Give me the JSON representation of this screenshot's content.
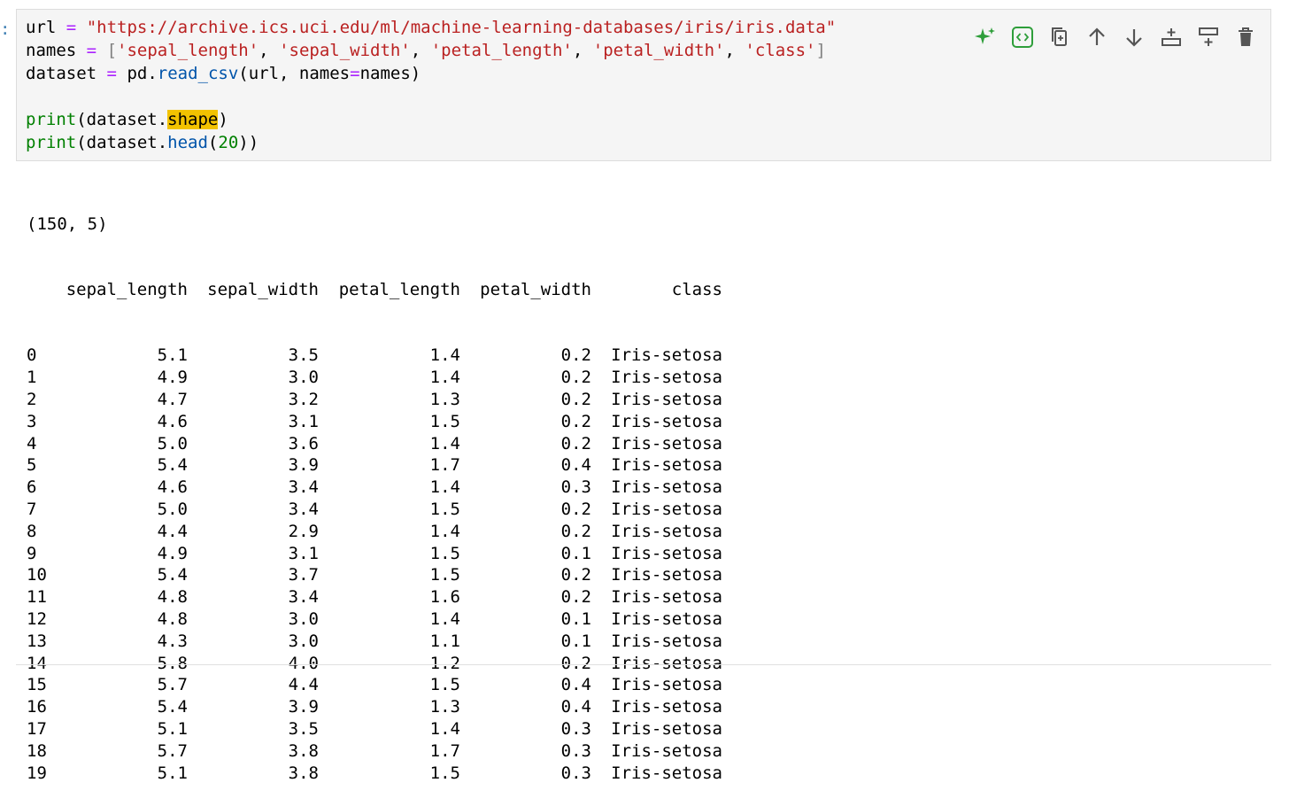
{
  "prompt": ":",
  "code": {
    "url_var": "url",
    "eq": "=",
    "url_string": "\"https://archive.ics.uci.edu/ml/machine-learning-databases/iris/iris.data\"",
    "names_var": "names",
    "open_bracket": "[",
    "close_bracket": "]",
    "comma": ",",
    "names_list": [
      "'sepal_length'",
      "'sepal_width'",
      "'petal_length'",
      "'petal_width'",
      "'class'"
    ],
    "dataset_var": "dataset",
    "pd": "pd.",
    "read_csv": "read_csv",
    "read_csv_args_a": "(url, names",
    "read_csv_args_b": "names)",
    "print": "print",
    "shape_prefix": "(dataset.",
    "shape_attr": "shape",
    "close_paren": ")",
    "head_prefix": "(dataset.",
    "head_func": "head",
    "head_open": "(",
    "head_arg": "20",
    "head_close": "))"
  },
  "toolbar": {
    "icons": [
      "sparkle-icon",
      "code-icon",
      "copy-icon",
      "arrow-up-icon",
      "arrow-down-icon",
      "insert-above-icon",
      "insert-below-icon",
      "trash-icon"
    ],
    "accent": "#2e9e3a"
  },
  "output": {
    "shape": "(150, 5)",
    "columns": [
      "sepal_length",
      "sepal_width",
      "petal_length",
      "petal_width",
      "class"
    ],
    "rows": [
      [
        "0",
        "5.1",
        "3.5",
        "1.4",
        "0.2",
        "Iris-setosa"
      ],
      [
        "1",
        "4.9",
        "3.0",
        "1.4",
        "0.2",
        "Iris-setosa"
      ],
      [
        "2",
        "4.7",
        "3.2",
        "1.3",
        "0.2",
        "Iris-setosa"
      ],
      [
        "3",
        "4.6",
        "3.1",
        "1.5",
        "0.2",
        "Iris-setosa"
      ],
      [
        "4",
        "5.0",
        "3.6",
        "1.4",
        "0.2",
        "Iris-setosa"
      ],
      [
        "5",
        "5.4",
        "3.9",
        "1.7",
        "0.4",
        "Iris-setosa"
      ],
      [
        "6",
        "4.6",
        "3.4",
        "1.4",
        "0.3",
        "Iris-setosa"
      ],
      [
        "7",
        "5.0",
        "3.4",
        "1.5",
        "0.2",
        "Iris-setosa"
      ],
      [
        "8",
        "4.4",
        "2.9",
        "1.4",
        "0.2",
        "Iris-setosa"
      ],
      [
        "9",
        "4.9",
        "3.1",
        "1.5",
        "0.1",
        "Iris-setosa"
      ],
      [
        "10",
        "5.4",
        "3.7",
        "1.5",
        "0.2",
        "Iris-setosa"
      ],
      [
        "11",
        "4.8",
        "3.4",
        "1.6",
        "0.2",
        "Iris-setosa"
      ],
      [
        "12",
        "4.8",
        "3.0",
        "1.4",
        "0.1",
        "Iris-setosa"
      ],
      [
        "13",
        "4.3",
        "3.0",
        "1.1",
        "0.1",
        "Iris-setosa"
      ],
      [
        "14",
        "5.8",
        "4.0",
        "1.2",
        "0.2",
        "Iris-setosa"
      ],
      [
        "15",
        "5.7",
        "4.4",
        "1.5",
        "0.4",
        "Iris-setosa"
      ],
      [
        "16",
        "5.4",
        "3.9",
        "1.3",
        "0.4",
        "Iris-setosa"
      ],
      [
        "17",
        "5.1",
        "3.5",
        "1.4",
        "0.3",
        "Iris-setosa"
      ],
      [
        "18",
        "5.7",
        "3.8",
        "1.7",
        "0.3",
        "Iris-setosa"
      ],
      [
        "19",
        "5.1",
        "3.8",
        "1.5",
        "0.3",
        "Iris-setosa"
      ]
    ]
  }
}
